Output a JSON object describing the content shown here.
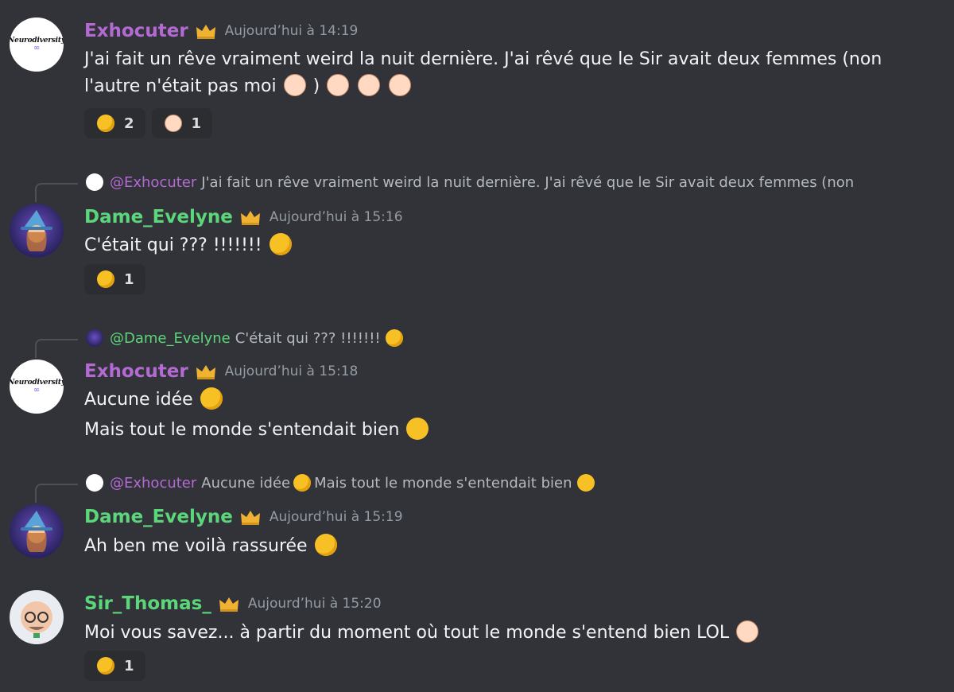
{
  "messages": [
    {
      "author": "Exhocuter",
      "timestamp": "Aujourd’hui à 14:19",
      "line1": "J'ai fait un rêve vraiment weird la nuit dernière. J'ai rêvé que le Sir avait deux femmes (non",
      "line2_a": "l'autre n'était pas moi",
      "line2_b": ")",
      "reactions": [
        {
          "icon": "rofl-emoji",
          "count": "2"
        },
        {
          "icon": "sir-face-emoji",
          "count": "1"
        }
      ]
    },
    {
      "reply_to": {
        "name": "@Exhocuter",
        "text": "J'ai fait un rêve vraiment weird la nuit dernière. J'ai rêvé que le Sir avait deux femmes (non"
      },
      "author": "Dame_Evelyne",
      "timestamp": "Aujourd’hui à 15:16",
      "text": "C'était qui ??? !!!!!!!",
      "reactions": [
        {
          "icon": "rofl-emoji",
          "count": "1"
        }
      ]
    },
    {
      "reply_to": {
        "name": "@Dame_Evelyne",
        "text": "C'était qui ??? !!!!!!!"
      },
      "author": "Exhocuter",
      "timestamp": "Aujourd’hui à 15:18",
      "line1": "Aucune idée",
      "line2": "Mais tout le monde s'entendait bien"
    },
    {
      "reply_to": {
        "name": "@Exhocuter",
        "text_a": "Aucune idée",
        "text_b": "Mais tout le monde s'entendait bien"
      },
      "author": "Dame_Evelyne",
      "timestamp": "Aujourd’hui à 15:19",
      "text": "Ah ben me voilà rassurée"
    },
    {
      "author": "Sir_Thomas_",
      "timestamp": "Aujourd’hui à 15:20",
      "text": "Moi vous savez... à partir du moment où tout le monde s'entend bien LOL",
      "reactions": [
        {
          "icon": "laughing-emoji",
          "count": "1"
        }
      ]
    }
  ],
  "avatar_logo_text": "Neurodiversity",
  "colors": {
    "background": "#313338",
    "exhocuter": "#b46ad3",
    "evelyne": "#5cd67a",
    "timestamp": "#949ba4",
    "reaction_bg": "#2b2d31",
    "crown": "#f0b232"
  }
}
